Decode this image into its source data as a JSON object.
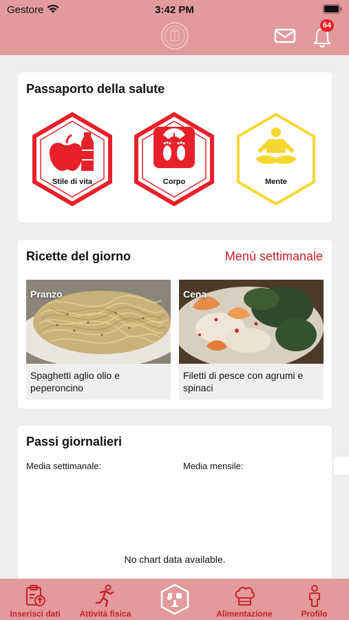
{
  "status": {
    "carrier": "Gestore",
    "time": "3:42 PM"
  },
  "header": {
    "notification_count": "64"
  },
  "colors": {
    "header_bg": "#e29a9c",
    "accent_red": "#c8202b",
    "hex_red": "#e8202a",
    "hex_yellow": "#f5d732"
  },
  "passport": {
    "title": "Passaporto della salute",
    "items": [
      {
        "label": "Stile di vita",
        "color": "#e8202a",
        "icon": "apple-bottle-icon"
      },
      {
        "label": "Corpo",
        "color": "#e8202a",
        "icon": "scale-icon"
      },
      {
        "label": "Mente",
        "color": "#f5d732",
        "icon": "meditation-icon"
      }
    ]
  },
  "recipes": {
    "title": "Ricette del giorno",
    "weekly_link": "Menù settimanale",
    "items": [
      {
        "meal": "Pranzo",
        "name": "Spaghetti aglio olio e peperoncino"
      },
      {
        "meal": "Cena",
        "name": "Filetti di pesce con agrumi e spinaci"
      }
    ]
  },
  "steps": {
    "title": "Passi giornalieri",
    "weekly_avg_label": "Media settimanale:",
    "monthly_avg_label": "Media mensile:",
    "no_data": "No chart data available."
  },
  "tabbar": {
    "items": [
      {
        "label": "Inserisci dati",
        "icon": "clipboard-upload-icon"
      },
      {
        "label": "Attività fisica",
        "icon": "running-icon"
      },
      {
        "label": "",
        "icon": "passport-hex-icon"
      },
      {
        "label": "Alimentazione",
        "icon": "chef-hat-icon"
      },
      {
        "label": "Profilo",
        "icon": "person-icon"
      }
    ]
  }
}
